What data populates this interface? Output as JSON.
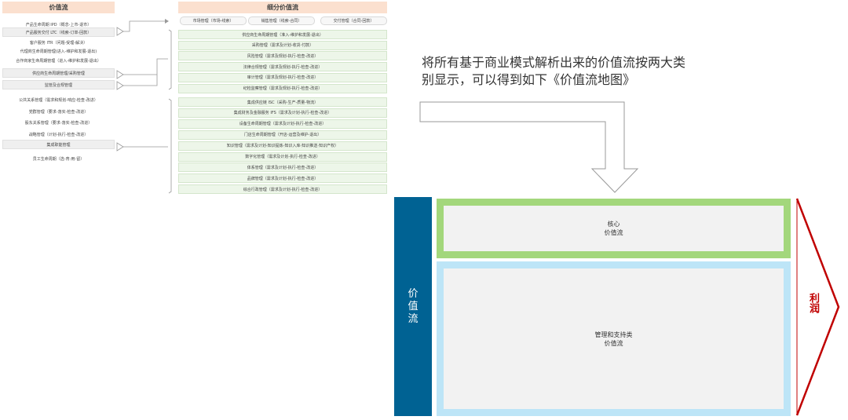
{
  "left": {
    "header": "价值流",
    "items": [
      "产品生命周期 IPD（概念-上市-退市）",
      "产品服务交付 LTC（线索-订单-回款）",
      "客户服务 ITR（问题-受理-解决）",
      "代理商生命周期管理(进入-维护和发展-退出)",
      "合作商家生命周期管理（进入-维护和发展-退出）",
      "供应商生命周期管理/采购管理",
      "监管及合规管理",
      "公共关系管理（需求和规划-响应-检查-改进）",
      "党群管理（要求-落实-检查-改进）",
      "股东关系管理（要求-落实-检查-改进）",
      "战略管理（计划-执行-检查-改进）",
      "集成职能管理",
      "员工生命周期（选-育-用-留）"
    ]
  },
  "right": {
    "header": "细分价值流",
    "pills": [
      "市场管理（市场-线索）",
      "销售管理（线索-合同）",
      "交付管理（合同-回款）"
    ],
    "group1": [
      "供应商生命周期管理（准入-维护和发展-退出）",
      "采购管理（需求及计划-收货-付款）",
      "风险管理（需求及规划-执行-检查-改进）",
      "法律合规管理（需求及规划-执行-检查-改进）",
      "审计管理（需求及规划-执行-检查-改进）",
      "纪检监察管理（需求及规划-执行-检查-改进）"
    ],
    "group2": [
      "集成供应链 ISC（采购-生产-质量-物流）",
      "集成财务及金融服务 IFS（需求及计划-执行-检查-改进）",
      "设备生命周期管理（需求及计划-执行-检查-改进）",
      "门店生命周期管理（开店-运营及维护-退出）",
      "知识管理（需求及计划-知识提炼-知识入库-知识推送-知识产权）",
      "数字化管理（需求及计划-执行-检查-改进）",
      "体系管理（需求及计划-执行-检查-改进）",
      "品牌管理（需求及计划-执行-检查-改进）",
      "综合行政管理（需求及计划-执行-检查-改进）"
    ]
  },
  "caption": {
    "line1": "将所有基于商业模式解析出来的价值流按两大类",
    "line2": "别显示，可以得到如下《价值流地图》"
  },
  "map": {
    "side_label": "价\n值\n流",
    "core_label": "核心\n价值流",
    "support_label": "管理和支持类\n价值流",
    "profit_label": "利润"
  },
  "colors": {
    "header_bg": "#fbe0cf",
    "side_bar": "#006293",
    "core_border": "#a3d77c",
    "support_border": "#bde5f7",
    "profit_arrow": "#c00000"
  }
}
